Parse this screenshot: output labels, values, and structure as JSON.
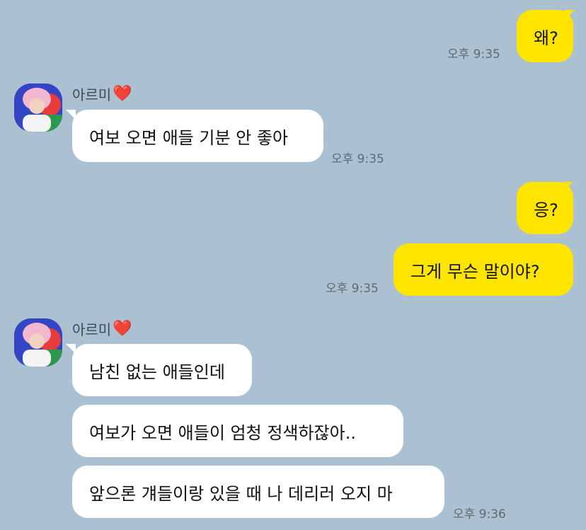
{
  "messages": [
    {
      "text": "왜?",
      "time": "오후 9:35"
    },
    {
      "sender": "아르미",
      "heart": "❤️",
      "text": "여보 오면 애들 기분 안 좋아",
      "time": "오후 9:35"
    },
    {
      "text": "응?"
    },
    {
      "text": "그게 무슨 말이야?",
      "time": "오후 9:35"
    },
    {
      "sender": "아르미",
      "heart": "❤️",
      "text": "남친 없는 애들인데"
    },
    {
      "text": "여보가 오면 애들이 엄청 정색하잖아.."
    },
    {
      "text": "앞으론 걔들이랑 있을 때 나 데리러 오지 마",
      "time": "오후 9:36"
    }
  ],
  "colors": {
    "background": "#abc1d1",
    "outgoing": "#fee500",
    "incoming": "#ffffff"
  }
}
